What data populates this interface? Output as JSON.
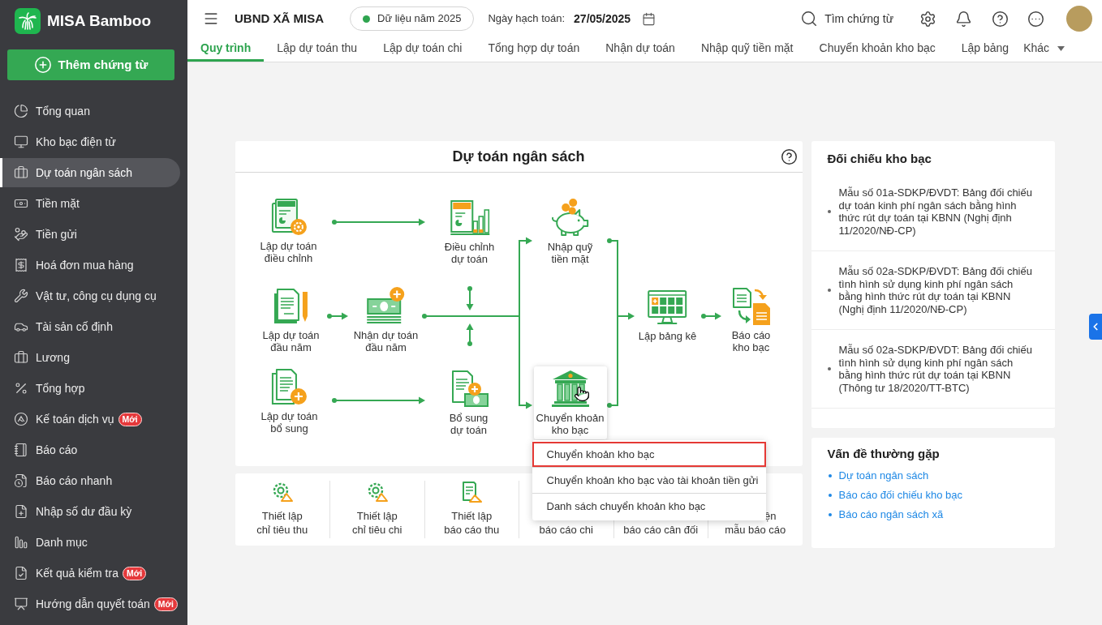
{
  "app": {
    "name": "MISA Bamboo",
    "add_button": "Thêm chứng từ"
  },
  "sidebar": {
    "items": [
      {
        "label": "Tổng quan",
        "selected": false
      },
      {
        "label": "Kho bạc điện tử",
        "selected": false
      },
      {
        "label": "Dự toán ngân sách",
        "selected": true
      },
      {
        "label": "Tiền mặt",
        "selected": false
      },
      {
        "label": "Tiền gửi",
        "selected": false
      },
      {
        "label": "Hoá đơn mua hàng",
        "selected": false
      },
      {
        "label": "Vật tư, công cụ dụng cụ",
        "selected": false
      },
      {
        "label": "Tài sản cố định",
        "selected": false
      },
      {
        "label": "Lương",
        "selected": false
      },
      {
        "label": "Tổng hợp",
        "selected": false
      },
      {
        "label": "Kế toán dịch vụ",
        "selected": false,
        "badge": "Mới"
      },
      {
        "label": "Báo cáo",
        "selected": false
      },
      {
        "label": "Báo cáo nhanh",
        "selected": false
      },
      {
        "label": "Nhập số dư đầu kỳ",
        "selected": false
      },
      {
        "label": "Danh mục",
        "selected": false
      },
      {
        "label": "Kết quả kiểm tra",
        "selected": false,
        "badge": "Mới"
      },
      {
        "label": "Hướng dẫn quyết toán",
        "selected": false,
        "badge": "Mới"
      }
    ]
  },
  "header": {
    "organization": "UBND XÃ MISA",
    "data_year": "Dữ liệu năm 2025",
    "date_label": "Ngày hạch toán:",
    "date": "27/05/2025",
    "search": "Tìm chứng từ"
  },
  "tabs": [
    {
      "label": "Quy trình",
      "selected": true
    },
    {
      "label": "Lập dự toán thu",
      "selected": false
    },
    {
      "label": "Lập dự toán chi",
      "selected": false
    },
    {
      "label": "Tổng hợp dự toán",
      "selected": false
    },
    {
      "label": "Nhận dự toán",
      "selected": false
    },
    {
      "label": "Nhập quỹ tiền mặt",
      "selected": false
    },
    {
      "label": "Chuyển khoản kho bạc",
      "selected": false
    },
    {
      "label": "Lập bảng",
      "selected": false
    }
  ],
  "more_tabs": "Khác",
  "process": {
    "title": "Dự toán ngân sách",
    "nodes": [
      {
        "lines": [
          "Lập dự toán",
          "điều chỉnh"
        ],
        "hovered": false
      },
      {
        "lines": [
          "Điều chỉnh",
          "dự toán"
        ],
        "hovered": false
      },
      {
        "lines": [
          "Nhập quỹ",
          "tiền mặt"
        ],
        "hovered": false
      },
      {
        "lines": [
          "Lập dự toán",
          "đầu năm"
        ],
        "hovered": false
      },
      {
        "lines": [
          "Nhận dự toán",
          "đầu năm"
        ],
        "hovered": false
      },
      {
        "lines": [
          "Lập bảng kê"
        ],
        "hovered": false
      },
      {
        "lines": [
          "Báo cáo",
          "kho bạc"
        ],
        "hovered": false
      },
      {
        "lines": [
          "Lập dự toán",
          "bổ sung"
        ],
        "hovered": false
      },
      {
        "lines": [
          "Bổ sung",
          "dự toán"
        ],
        "hovered": false
      },
      {
        "lines": [
          "Chuyển khoản",
          "kho bạc"
        ],
        "hovered": true
      }
    ],
    "menu": [
      {
        "label": "Chuyển khoản kho bạc",
        "selected": true
      },
      {
        "label": "Chuyển khoản kho bạc vào tài khoản tiền gửi",
        "selected": false
      },
      {
        "label": "Danh sách chuyển khoản kho bạc",
        "selected": false
      }
    ]
  },
  "tiles": [
    {
      "lines": [
        "Thiết lập",
        "chỉ tiêu thu"
      ]
    },
    {
      "lines": [
        "Thiết lập",
        "chỉ tiêu chi"
      ]
    },
    {
      "lines": [
        "Thiết lập",
        "báo cáo thu"
      ]
    },
    {
      "lines": [
        "báo cáo chi"
      ]
    },
    {
      "lines": [
        "báo cáo cân đối"
      ]
    },
    {
      "lines": [
        "ện",
        "mẫu báo cáo"
      ]
    }
  ],
  "reconciliation": {
    "title": "Đối chiếu kho bạc",
    "items": [
      "Mẫu số 01a-SDKP/ĐVDT: Bảng đối chiếu dự toán kinh phí ngân sách bằng hình thức rút dự toán tại KBNN (Nghị định 11/2020/NĐ-CP)",
      "Mẫu số 02a-SDKP/ĐVDT: Bảng đối chiếu tình hình sử dụng kinh phí ngân sách bằng hình thức rút dự toán tại KBNN (Nghị định 11/2020/NĐ-CP)",
      "Mẫu số 02a-SDKP/ĐVDT: Bảng đối chiếu tình hình sử dụng kinh phí ngân sách bằng hình thức rút dự toán tại KBNN (Thông tư 18/2020/TT-BTC)"
    ]
  },
  "faq": {
    "title": "Vấn đề thường gặp",
    "links": [
      "Dự toán ngân sách",
      "Báo cáo đối chiếu kho bạc",
      "Báo cáo ngân sách xã"
    ]
  }
}
